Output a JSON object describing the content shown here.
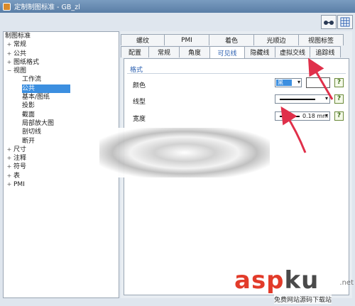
{
  "window": {
    "title": "定制制图标准 - GB_zl"
  },
  "toolbar": {
    "btn1_icon": "glasses-icon",
    "btn2_icon": "grid-icon"
  },
  "tree": {
    "items": [
      {
        "label": "制图标准",
        "level": 0,
        "expander": ""
      },
      {
        "label": "常规",
        "level": 1,
        "expander": "+"
      },
      {
        "label": "公共",
        "level": 1,
        "expander": "+"
      },
      {
        "label": "图纸格式",
        "level": 1,
        "expander": "+"
      },
      {
        "label": "视图",
        "level": 1,
        "expander": "−"
      },
      {
        "label": "工作流",
        "level": 2,
        "expander": ""
      },
      {
        "label": "公共",
        "level": 2,
        "expander": "",
        "selected": true
      },
      {
        "label": "基本/图纸",
        "level": 2,
        "expander": ""
      },
      {
        "label": "投影",
        "level": 2,
        "expander": ""
      },
      {
        "label": "截面",
        "level": 2,
        "expander": ""
      },
      {
        "label": "局部放大图",
        "level": 2,
        "expander": ""
      },
      {
        "label": "剖切线",
        "level": 2,
        "expander": ""
      },
      {
        "label": "断开",
        "level": 2,
        "expander": ""
      },
      {
        "label": "尺寸",
        "level": 1,
        "expander": "+"
      },
      {
        "label": "注释",
        "level": 1,
        "expander": "+"
      },
      {
        "label": "符号",
        "level": 1,
        "expander": "+"
      },
      {
        "label": "表",
        "level": 1,
        "expander": "+"
      },
      {
        "label": "PMI",
        "level": 1,
        "expander": "+"
      }
    ]
  },
  "tabs_top": [
    "螺纹",
    "PMI",
    "着色",
    "光顺边",
    "视图标签"
  ],
  "tabs_bottom": [
    "配置",
    "常规",
    "角度",
    "可见线",
    "隐藏线",
    "虚拟交线",
    "追踪线"
  ],
  "active_tab": "可见线",
  "format": {
    "group_title": "格式",
    "color_label": "颜色",
    "color_value": "黑",
    "linetype_label": "线型",
    "width_label": "宽度",
    "width_value": "0.18 mm",
    "help": "?"
  },
  "watermark": {
    "logo_a": "asp",
    "logo_b": "ku",
    "tld": ".net",
    "sub": "免费网站源码下载站"
  },
  "colors": {
    "accent": "#3c8fe0",
    "arrow": "#e0304a"
  }
}
